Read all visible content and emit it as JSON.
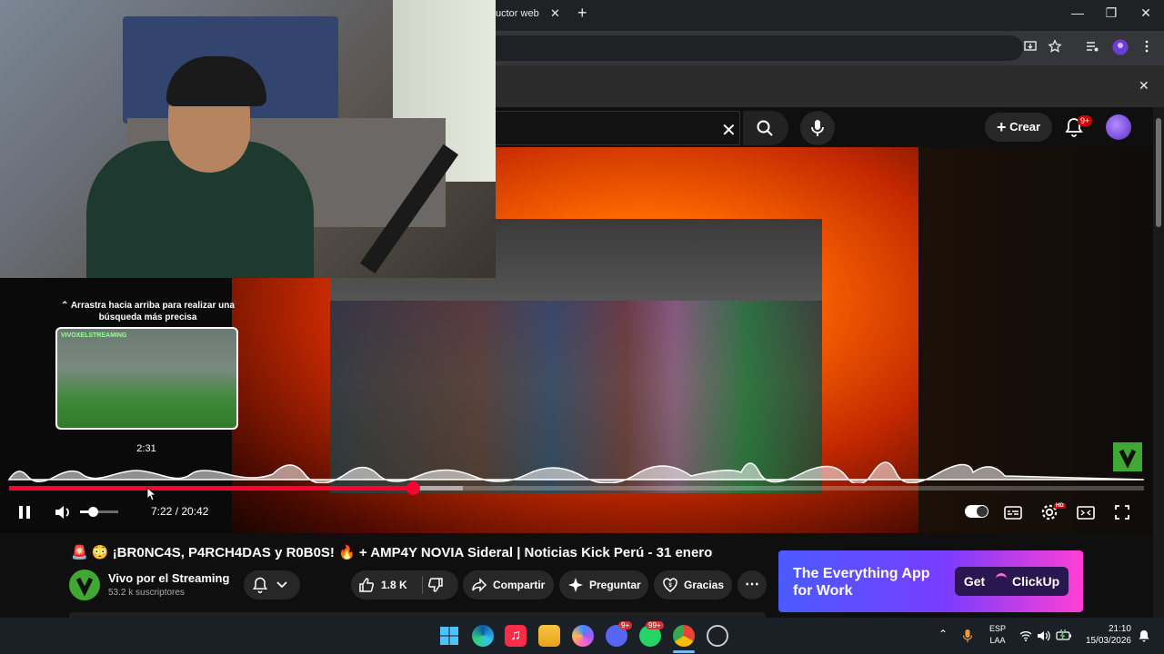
{
  "browser": {
    "tab_title": "uctor web",
    "tab_close_glyph": "✕",
    "new_tab_glyph": "+",
    "window_controls": [
      "—",
      "❐",
      "✕"
    ],
    "infobar_close_glyph": "✕"
  },
  "youtube_header": {
    "search_clear_glyph": "✕",
    "create_label": "Crear",
    "notifications_badge": "9+"
  },
  "player": {
    "drag_hint": "⌃ Arrastra hacia arriba para realizar una búsqueda más precisa",
    "preview_channel_tag": "VIVOXELSTREAMING",
    "preview_time": "2:31",
    "time_readout": "7:22 / 20:42",
    "progress_played_fraction": 0.356,
    "progress_buffered_fraction": 0.4,
    "volume_fraction": 0.33,
    "autoplay_on": true,
    "settings_badge": "HD"
  },
  "video": {
    "title": "🚨 😳 ¡BR0NC4S, P4RCH4DAS y R0B0S! 🔥 + AMP4Y NOVIA Sideral | Noticias Kick Perú - 31 enero",
    "channel_name": "Vivo por el Streaming",
    "subscribers": "53.2 k suscriptores",
    "likes": "1.8 K",
    "share_label": "Compartir",
    "ask_label": "Preguntar",
    "thanks_label": "Gracias",
    "more_glyph": "⋯"
  },
  "ad": {
    "headline": "The Everything App for Work",
    "cta": "Get",
    "brand": "ClickUp"
  },
  "taskbar": {
    "badges": [
      "9+",
      "99+"
    ],
    "language": "ESP",
    "layout": "LAA",
    "time": "21:10",
    "date": "15/03/2026"
  },
  "colors": {
    "youtube_red": "#ff0033",
    "chrome_dark": "#202124",
    "taskbar": "#1b1f26",
    "channel_green": "#3fa832"
  }
}
